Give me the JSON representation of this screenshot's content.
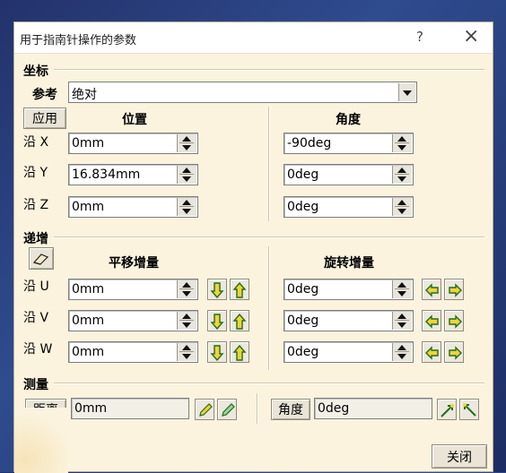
{
  "window": {
    "title": "用于指南针操作的参数",
    "help": "?",
    "close": "×"
  },
  "coords": {
    "group": "坐标",
    "reference_label": "参考",
    "reference_value": "绝对",
    "apply_button": "应用",
    "position_header": "位置",
    "angle_header": "角度",
    "rows": [
      {
        "label": "沿 X",
        "position": "0mm",
        "angle": "-90deg"
      },
      {
        "label": "沿 Y",
        "position": "16.834mm",
        "angle": "0deg"
      },
      {
        "label": "沿 Z",
        "position": "0mm",
        "angle": "0deg"
      }
    ]
  },
  "increment": {
    "group": "递增",
    "translation_header": "平移增量",
    "rotation_header": "旋转增量",
    "rows": [
      {
        "label": "沿 U",
        "translation": "0mm",
        "rotation": "0deg"
      },
      {
        "label": "沿 V",
        "translation": "0mm",
        "rotation": "0deg"
      },
      {
        "label": "沿 W",
        "translation": "0mm",
        "rotation": "0deg"
      }
    ]
  },
  "measure": {
    "group": "测量",
    "distance_button": "距离",
    "distance_value": "0mm",
    "angle_button": "角度",
    "angle_value": "0deg"
  },
  "footer": {
    "close_button": "关闭"
  },
  "colors": {
    "dialog_bg": "#fbf3de",
    "arrow_green": "#2e8b2e",
    "arrow_yellow": "#f2d23a"
  }
}
